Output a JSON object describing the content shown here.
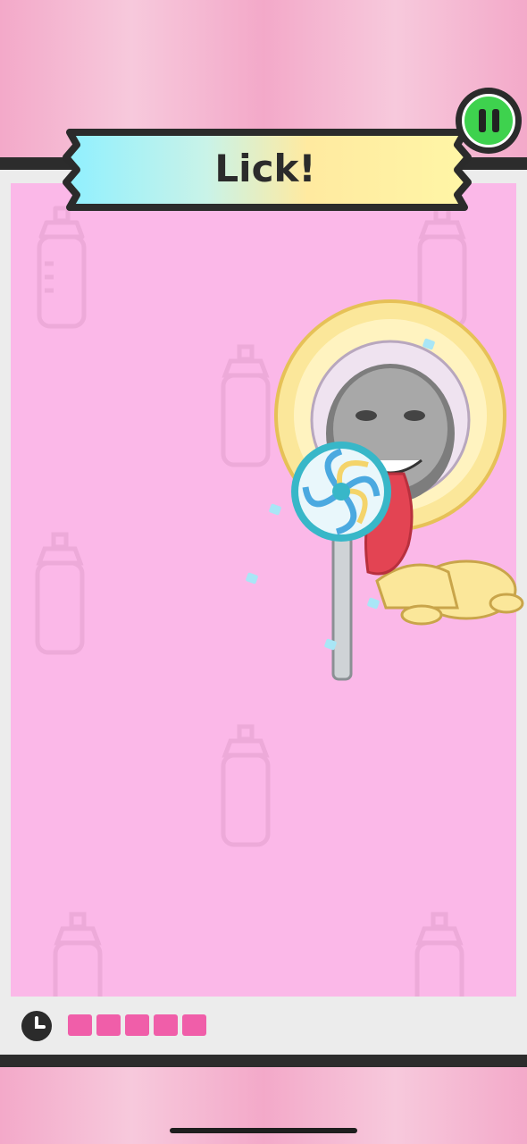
{
  "game": {
    "prompt": "Lick!",
    "timer_blocks_remaining": 5,
    "timer_blocks_total": 5
  },
  "controls": {
    "pause_icon": "pause-icon",
    "timer_icon": "clock-icon"
  },
  "colors": {
    "play_area": "#fbb8e8",
    "timer_block": "#f05ea9",
    "pause_button": "#3ed24e",
    "frame": "#2c2c2c"
  },
  "scene": {
    "character": "baby-costume-character",
    "object": "lollipop"
  }
}
